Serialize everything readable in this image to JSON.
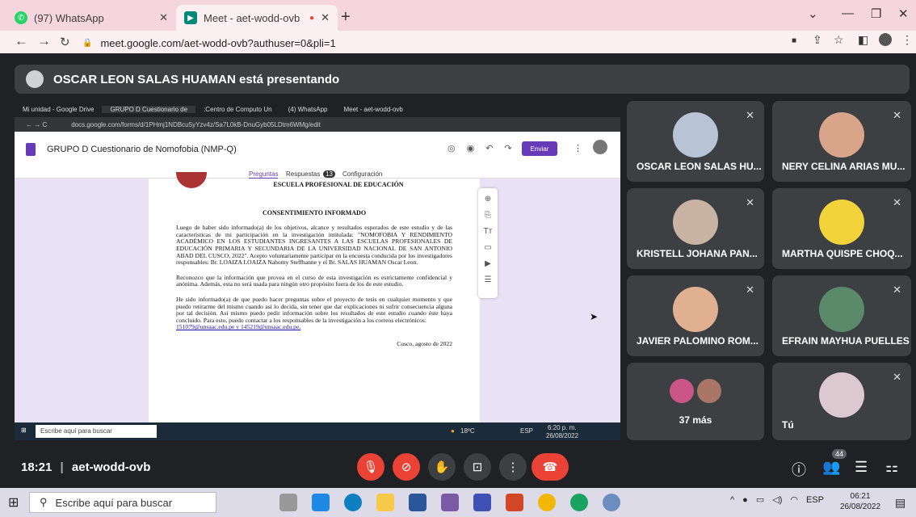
{
  "browser": {
    "tabs": [
      {
        "label": "(97) WhatsApp"
      },
      {
        "label": "Meet - aet-wodd-ovb"
      }
    ],
    "url": "meet.google.com/aet-wodd-ovb?authuser=0&pli=1"
  },
  "meet": {
    "presenting_banner": "OSCAR LEON SALAS HUAMAN está presentando",
    "time": "18:21",
    "meeting_code": "aet-wodd-ovb",
    "participant_count": "44",
    "participants": [
      {
        "name": "OSCAR LEON SALAS HU..."
      },
      {
        "name": "NERY CELINA ARIAS MU..."
      },
      {
        "name": "KRISTELL JOHANA PAN..."
      },
      {
        "name": "MARTHA QUISPE CHOQ..."
      },
      {
        "name": "JAVIER PALOMINO ROM..."
      },
      {
        "name": "EFRAIN MAYHUA PUELLES"
      },
      {
        "name": "37 más"
      },
      {
        "name": "Tú"
      }
    ]
  },
  "shared_screen": {
    "tabs": [
      "Mi unidad - Google Drive",
      "GRUPO D Cuestionario de",
      ":Centro de Computo Un",
      "(4) WhatsApp",
      "Meet - aet-wodd-ovb"
    ],
    "url": "docs.google.com/forms/d/1PHmj1NDBcu5yYzv4z/Sa7L0kB-DnuGyb05LDtm6WMg/edit",
    "form_title": "GRUPO D Cuestionario de Nomofobia (NMP-Q)",
    "send_label": "Enviar",
    "form_tabs": {
      "questions": "Preguntas",
      "responses": "Respuestas",
      "responses_count": "13",
      "settings": "Configuración"
    },
    "doc": {
      "school": "ESCUELA PROFESIONAL DE EDUCACIÓN",
      "heading": "CONSENTIMIENTO INFORMADO",
      "p1": "Luego de haber sido informado(a) de los objetivos, alcance y resultados esperados de este estudio y de las características de mi participación en la investigación intitulada: \"NOMOFOBIA Y RENDIMIENTO ACADÉMICO EN LOS ESTUDIANTES INGRESANTES A LAS ESCUELAS PROFESIONALES DE EDUCACIÓN PRIMARIA Y SECUNDARIA DE LA UNIVERSIDAD NACIONAL DE SAN ANTONIO ABAD DEL CUSCO, 2022\". Acepto voluntariamente participar en la encuesta conducida por los investigadores responsables: Br. LOAIZA LOAIZA Nahomy Steffhanne y el Br. SALAS HUAMAN Oscar Leon.",
      "p2": "Reconozco que la información que provea en el curso de esta investigación es estrictamente confidencial y anónima. Además, esta no será usada para ningún otro propósito fuera de los de este estudio.",
      "p3": "He sido informado(a) de que puedo hacer preguntas sobre el proyecto de tesis en cualquier momento y que puedo retirarme del mismo cuando así lo decida, sin tener que dar explicaciones ni sufrir consecuencia alguna por tal decisión. Así mismo puedo pedir información sobre los resultados de este estudio cuando éste haya concluido. Para esto, puedo contactar a los responsables de la investigación a los correos electrónicos:",
      "emails": "151079@unsaac.edu.pe y 145219@unsaac.edu.pe.",
      "date": "Cusco, agosto de 2022"
    },
    "taskbar_search": "Escribe aquí para buscar",
    "weather": "18ºC",
    "lang": "ESP",
    "time": "6:20 p. m.",
    "date": "26/08/2022"
  },
  "taskbar": {
    "search_placeholder": "Escribe aquí para buscar",
    "lang": "ESP",
    "time": "06:21",
    "date": "26/08/2022"
  },
  "colors": {
    "tabbar": "#f5d6de",
    "meet_bg": "#202124",
    "tile": "#3c4043",
    "red": "#ea4335",
    "forms_purple": "#673ab7"
  }
}
